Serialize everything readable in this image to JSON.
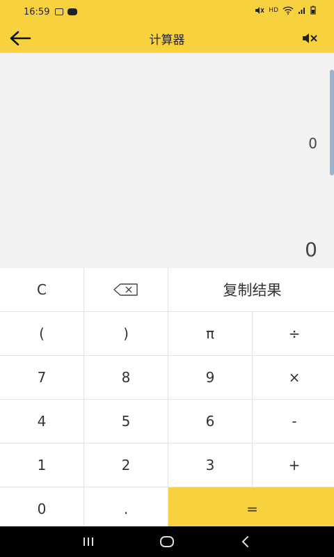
{
  "status_bar": {
    "time": "16:59",
    "right_text": "HD"
  },
  "app_bar": {
    "title": "计算器"
  },
  "display": {
    "expression": "0",
    "result": "0"
  },
  "keys": {
    "clear": "C",
    "copy_result": "复制结果",
    "left_paren": "(",
    "right_paren": ")",
    "pi": "π",
    "divide": "÷",
    "seven": "7",
    "eight": "8",
    "nine": "9",
    "multiply": "×",
    "four": "4",
    "five": "5",
    "six": "6",
    "minus": "-",
    "one": "1",
    "two": "2",
    "three": "3",
    "plus": "+",
    "zero": "0",
    "dot": ".",
    "equals": "="
  },
  "icons": {
    "back": "arrow-left-icon",
    "mute": "volume-mute-icon",
    "backspace": "backspace-icon",
    "nav_recent": "recent-apps-icon",
    "nav_home": "home-icon",
    "nav_back": "chevron-left-icon"
  },
  "colors": {
    "accent": "#f7d23e",
    "display_bg": "#f2f2f2",
    "nav_bg": "#000000"
  }
}
